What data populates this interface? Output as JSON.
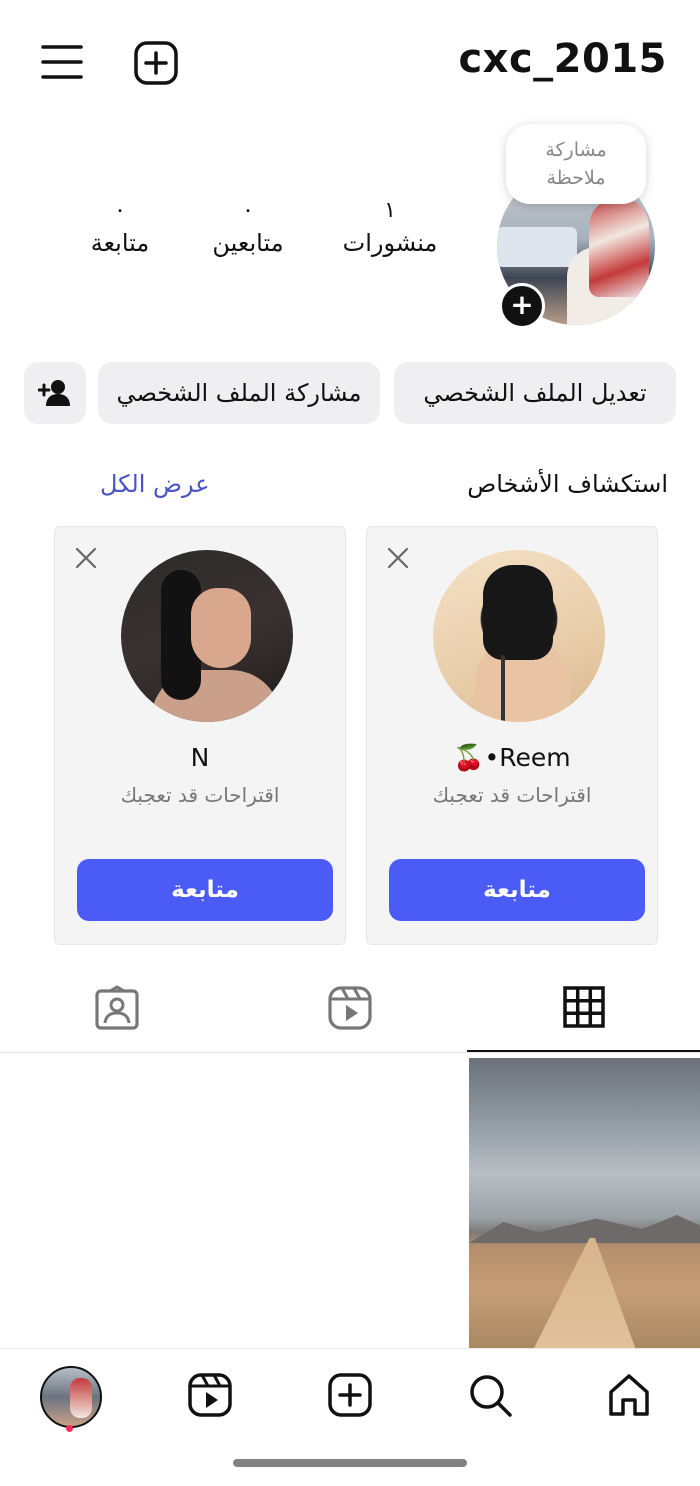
{
  "header": {
    "username": "cxc_2015",
    "menu_icon": "hamburger-menu-icon",
    "create_icon": "plus-square-icon"
  },
  "note": {
    "line1": "مشاركة",
    "line2": "ملاحظة"
  },
  "stats": {
    "posts": {
      "count": "١",
      "label": "منشورات"
    },
    "followers": {
      "count": "٠",
      "label": "متابعين"
    },
    "following": {
      "count": "٠",
      "label": "متابعة"
    }
  },
  "actions": {
    "edit_profile": "تعديل الملف الشخصي",
    "share_profile": "مشاركة الملف الشخصي"
  },
  "discover": {
    "title": "استكشاف الأشخاص",
    "see_all": "عرض الكل",
    "cards": [
      {
        "name": "🍒•Reem",
        "subtitle": "اقتراحات قد تعجبك",
        "follow_label": "متابعة"
      },
      {
        "name": "N",
        "subtitle": "اقتراحات قد تعجبك",
        "follow_label": "متابعة"
      }
    ]
  },
  "tabs": [
    "grid-icon",
    "reels-icon",
    "tagged-icon"
  ],
  "bottom_nav": [
    "home-icon",
    "search-icon",
    "create-icon",
    "reels-icon",
    "profile-avatar"
  ],
  "colors": {
    "accent_blue": "#4a5cf5",
    "link_blue": "#4a53c8",
    "notification_dot": "#ff2d55"
  }
}
